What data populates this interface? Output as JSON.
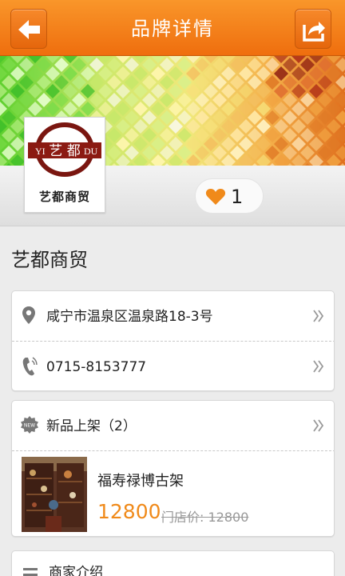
{
  "header": {
    "title": "品牌详情",
    "back_icon": "back-arrow-icon",
    "share_icon": "share-icon"
  },
  "banner": {
    "colors": [
      "#5fd02f",
      "#cde86a",
      "#f1e87b",
      "#f4a83c",
      "#9a1d14"
    ]
  },
  "brand": {
    "logo_text_left": "YI",
    "logo_text_center": "艺 都",
    "logo_text_right": "DU",
    "logo_caption": "艺都商贸",
    "like_count": "1",
    "name": "艺都商贸"
  },
  "contact": {
    "address": "咸宁市温泉区温泉路18-3号",
    "phone": "0715-8153777"
  },
  "new_products": {
    "label": "新品上架（2）",
    "new_badge": "NEW",
    "item": {
      "name": "福寿禄博古架",
      "price": "12800",
      "store_price": "门店价: 12800"
    }
  },
  "intro": {
    "label": "商家介绍"
  }
}
